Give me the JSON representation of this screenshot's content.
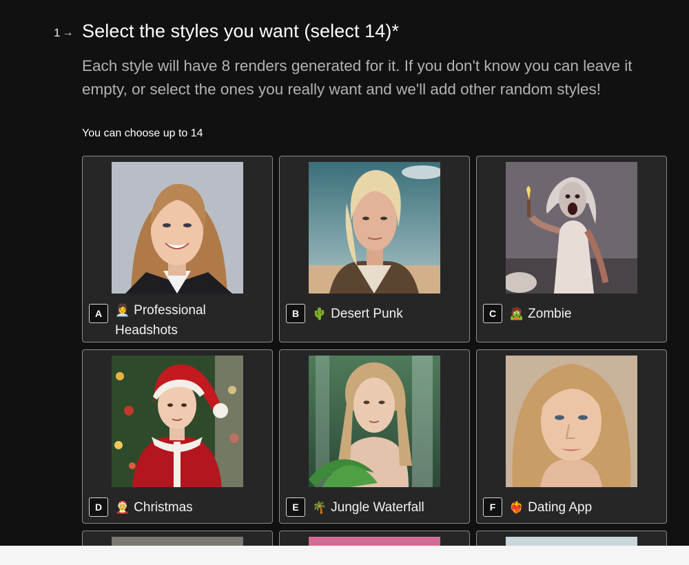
{
  "question": {
    "number": "1",
    "arrow": "→",
    "title": "Select the styles you want (select 14)*",
    "description": "Each style will have 8 renders generated for it. If you don't know you can leave it empty, or select the ones you really want and we'll add other random styles!",
    "hint": "You can choose up to 14"
  },
  "options": [
    {
      "key": "A",
      "emoji": "👩‍💼",
      "label": "Professional Headshots",
      "image": "professional-headshot-woman"
    },
    {
      "key": "B",
      "emoji": "🌵",
      "label": "Desert Punk",
      "image": "desert-punk-woman"
    },
    {
      "key": "C",
      "emoji": "🧟",
      "label": "Zombie",
      "image": "zombie-woman-torch"
    },
    {
      "key": "D",
      "emoji": "🤶",
      "label": "Christmas",
      "image": "christmas-woman-santa-hat"
    },
    {
      "key": "E",
      "emoji": "🌴",
      "label": "Jungle Waterfall",
      "image": "jungle-waterfall-woman"
    },
    {
      "key": "F",
      "emoji": "❤️‍🔥",
      "label": "Dating App",
      "image": "dating-app-woman-portrait"
    }
  ]
}
